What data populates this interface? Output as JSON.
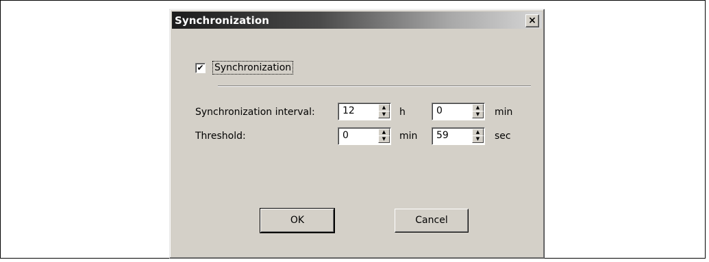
{
  "dialog": {
    "title": "Synchronization",
    "close_label": "×"
  },
  "sync_checkbox": {
    "checked": true,
    "check_glyph": "✔",
    "label": "Synchronization"
  },
  "interval": {
    "label": "Synchronization interval:",
    "hours_value": "12",
    "hours_unit": "h",
    "minutes_value": "0",
    "minutes_unit": "min"
  },
  "threshold": {
    "label": "Threshold:",
    "minutes_value": "0",
    "minutes_unit": "min",
    "seconds_value": "59",
    "seconds_unit": "sec"
  },
  "buttons": {
    "ok_label": "OK",
    "cancel_label": "Cancel"
  },
  "icons": {
    "spin_up": "▲",
    "spin_down": "▼"
  }
}
